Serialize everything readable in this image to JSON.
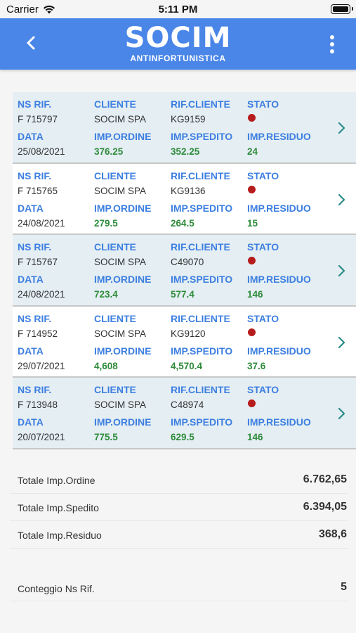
{
  "status_bar": {
    "carrier": "Carrier",
    "time": "5:11 PM"
  },
  "header": {
    "brand": "SOCIM",
    "subtitle": "ANTINFORTUNISTICA"
  },
  "labels": {
    "ns_rif": "NS RIF.",
    "cliente": "CLIENTE",
    "rif_cliente": "RIF.CLIENTE",
    "stato": "STATO",
    "data": "DATA",
    "imp_ordine": "IMP.ORDINE",
    "imp_spedito": "IMP.SPEDITO",
    "imp_residuo": "IMP.RESIDUO"
  },
  "orders": [
    {
      "ns_rif": "F 715797",
      "cliente": "SOCIM SPA",
      "rif_cliente": "KG9159",
      "data": "25/08/2021",
      "imp_ordine": "376.25",
      "imp_spedito": "352.25",
      "imp_residuo": "24",
      "stato_color": "#b71c1c"
    },
    {
      "ns_rif": "F 715765",
      "cliente": "SOCIM SPA",
      "rif_cliente": "KG9136",
      "data": "24/08/2021",
      "imp_ordine": "279.5",
      "imp_spedito": "264.5",
      "imp_residuo": "15",
      "stato_color": "#b71c1c"
    },
    {
      "ns_rif": "F 715767",
      "cliente": "SOCIM SPA",
      "rif_cliente": "C49070",
      "data": "24/08/2021",
      "imp_ordine": "723.4",
      "imp_spedito": "577.4",
      "imp_residuo": "146",
      "stato_color": "#b71c1c"
    },
    {
      "ns_rif": "F 714952",
      "cliente": "SOCIM SPA",
      "rif_cliente": "KG9120",
      "data": "29/07/2021",
      "imp_ordine": "4,608",
      "imp_spedito": "4,570.4",
      "imp_residuo": "37.6",
      "stato_color": "#b71c1c"
    },
    {
      "ns_rif": "F 713948",
      "cliente": "SOCIM SPA",
      "rif_cliente": "C48974",
      "data": "20/07/2021",
      "imp_ordine": "775.5",
      "imp_spedito": "629.5",
      "imp_residuo": "146",
      "stato_color": "#b71c1c"
    }
  ],
  "totals": [
    {
      "label": "Totale Imp.Ordine",
      "value": "6.762,65"
    },
    {
      "label": "Totale Imp.Spedito",
      "value": "6.394,05"
    },
    {
      "label": "Totale Imp.Residuo",
      "value": "368,6"
    }
  ],
  "count": {
    "label": "Conteggio Ns Rif.",
    "value": "5"
  },
  "colors": {
    "header_bg": "#4a86e8",
    "label_blue": "#3d7fe0",
    "value_green": "#2e8b3a",
    "status_red": "#b71c1c"
  },
  "icons": {
    "back": "chevron-left-icon",
    "menu": "more-vertical-icon",
    "row": "chevron-right-icon",
    "wifi": "wifi-icon",
    "battery": "battery-icon"
  }
}
